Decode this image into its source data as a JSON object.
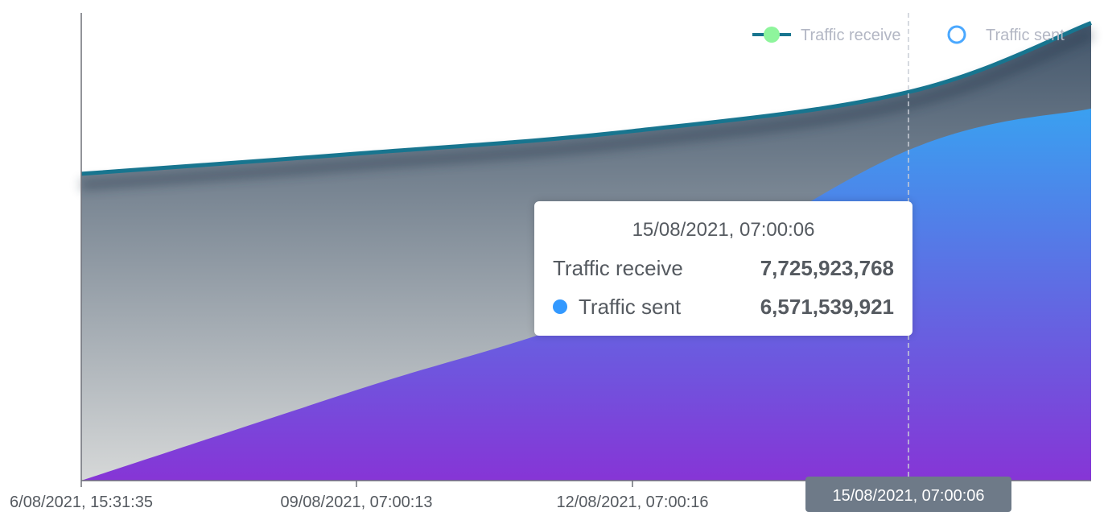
{
  "chart_data": {
    "type": "area",
    "x": [
      "06/08/2021, 15:31:35",
      "09/08/2021, 07:00:13",
      "12/08/2021, 07:00:16",
      "15/08/2021, 07:00:06"
    ],
    "x_tick_labels": [
      "6/08/2021, 15:31:35",
      "09/08/2021, 07:00:13",
      "12/08/2021, 07:00:16"
    ],
    "series": [
      {
        "name": "Traffic receive",
        "values": [
          6100000000,
          6500000000,
          6950000000,
          7725923768
        ],
        "end_value": 9100000000,
        "line_color": "#18758f",
        "legend_color": "#8ef59c"
      },
      {
        "name": "Traffic sent",
        "values": [
          0,
          1800000000,
          3600000000,
          6571539921
        ],
        "end_value": 7400000000,
        "legend_color": "#4aa8ff",
        "fill_top": "#3aa0f0",
        "fill_bottom": "#8635d6"
      }
    ],
    "legend": {
      "position": "top-right"
    },
    "grid": false,
    "ylim": [
      0,
      9300000000
    ],
    "axis_pointer": "15/08/2021, 07:00:06",
    "tooltip": {
      "title": "15/08/2021, 07:00:06",
      "rows": [
        {
          "label": "Traffic receive",
          "value": "7,725,923,768",
          "marker_color": ""
        },
        {
          "label": "Traffic sent",
          "value": "6,571,539,921",
          "marker_color": "#3399ff"
        }
      ]
    }
  }
}
